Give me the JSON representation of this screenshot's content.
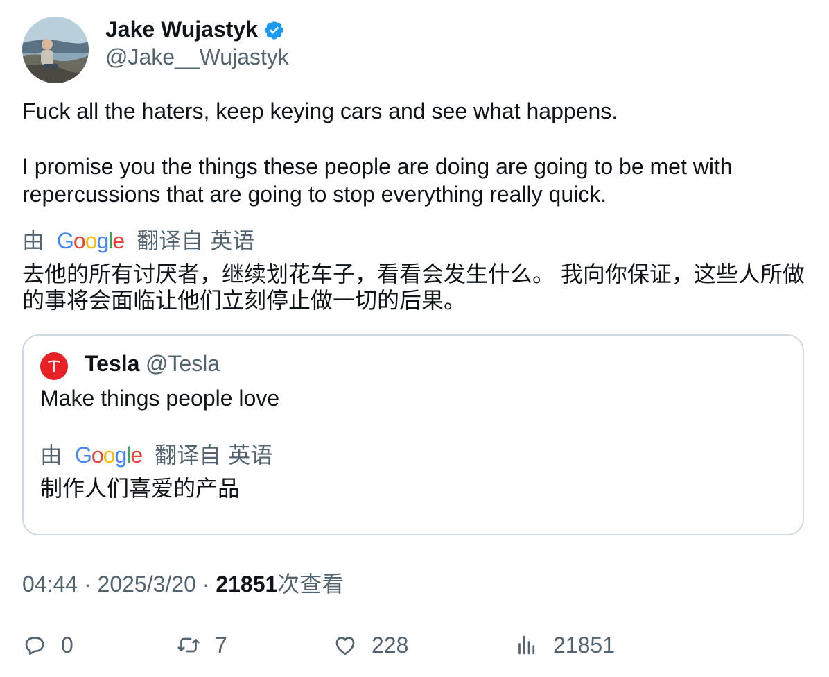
{
  "author": {
    "display_name": "Jake Wujastyk",
    "handle": "@Jake__Wujastyk",
    "verified": true
  },
  "tweet": {
    "text": "Fuck all the haters, keep keying cars and see what happens.\n\nI promise you the things these people are doing are going to be met with repercussions that are going to stop everything really quick.",
    "translation": {
      "by_label": "由",
      "provider": "Google",
      "from_label": "翻译自",
      "language": "英语",
      "text": "去他的所有讨厌者，继续划花车子，看看会发生什么。 我向你保证，这些人所做的事将会面临让他们立刻停止做一切的后果。"
    }
  },
  "quoted_tweet": {
    "name": "Tesla",
    "handle": "@Tesla",
    "text": "Make things people love",
    "translation": {
      "by_label": "由",
      "provider": "Google",
      "from_label": "翻译自",
      "language": "英语",
      "text": "制作人们喜爱的产品"
    }
  },
  "meta": {
    "time": "04:44",
    "separator": " · ",
    "date": "2025/3/20",
    "views_count": "21851",
    "views_label": "次查看"
  },
  "actions": {
    "replies": "0",
    "retweets": "7",
    "likes": "228",
    "views": "21851"
  },
  "colors": {
    "text_primary": "#0f1419",
    "text_secondary": "#536471",
    "verified_blue": "#1d9bf0",
    "tesla_red": "#e82127",
    "border": "#cfd9de"
  },
  "icons": [
    "verified-badge-icon",
    "tesla-logo-icon",
    "reply-icon",
    "retweet-icon",
    "like-icon",
    "views-icon"
  ]
}
